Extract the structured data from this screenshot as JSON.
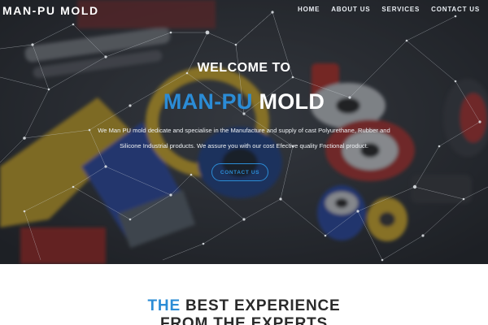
{
  "brand": {
    "name": "MAN-PU MOLD"
  },
  "nav": {
    "items": [
      "HOME",
      "ABOUT US",
      "SERVICES",
      "CONTACT US"
    ]
  },
  "hero": {
    "welcome": "WELCOME TO",
    "title_accent": "MAN-PU",
    "title_rest": "MOLD",
    "description_line1": "We Man PU mold dedicate and specialise in the Manufacture and supply of cast Polyurethane, Rubber and",
    "description_line2": "Silicone Industrial products. We assure you with our cost Efective quality Fnctional product.",
    "cta_label": "CONTACT US"
  },
  "section": {
    "heading_accent": "THE",
    "heading_rest": "BEST EXPERIENCE",
    "heading_line2": "FROM THE EXPERTS"
  },
  "colors": {
    "accent": "#2b8cd6",
    "hero_overlay": "#1c2026",
    "heading_dark": "#2a2a2a"
  }
}
